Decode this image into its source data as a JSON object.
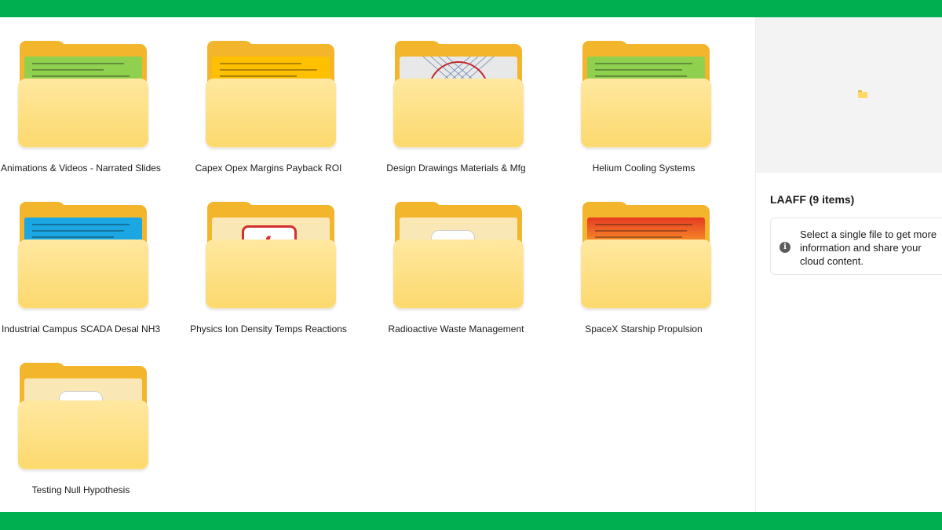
{
  "colors": {
    "frame": "#00b050",
    "folder_back": "#f2b52c",
    "folder_front": "#fcd96d"
  },
  "folders": [
    {
      "label": "Animations & Videos - Narrated Slides",
      "preview": "green-text-document"
    },
    {
      "label": "Capex Opex Margins Payback ROI",
      "preview": "orange-text-document"
    },
    {
      "label": "Design Drawings Materials & Mfg",
      "preview": "technical-drawing"
    },
    {
      "label": "Helium Cooling Systems",
      "preview": "green-text-document"
    },
    {
      "label": "Industrial Campus SCADA Desal NH3",
      "preview": "blue-text-document"
    },
    {
      "label": "Physics Ion Density Temps Reactions",
      "preview": "pdf-icon"
    },
    {
      "label": "Radioactive Waste Management",
      "preview": "excel-icon"
    },
    {
      "label": "SpaceX Starship Propulsion",
      "preview": "red-yellow-text-document"
    },
    {
      "label": "Testing Null Hypothesis",
      "preview": "app-icon"
    }
  ],
  "details": {
    "title": "LAAFF (9 items)",
    "info_icon": "info-icon",
    "info_text": "Select a single file to get more information and share your cloud content.",
    "preview_icon": "folder-icon"
  }
}
